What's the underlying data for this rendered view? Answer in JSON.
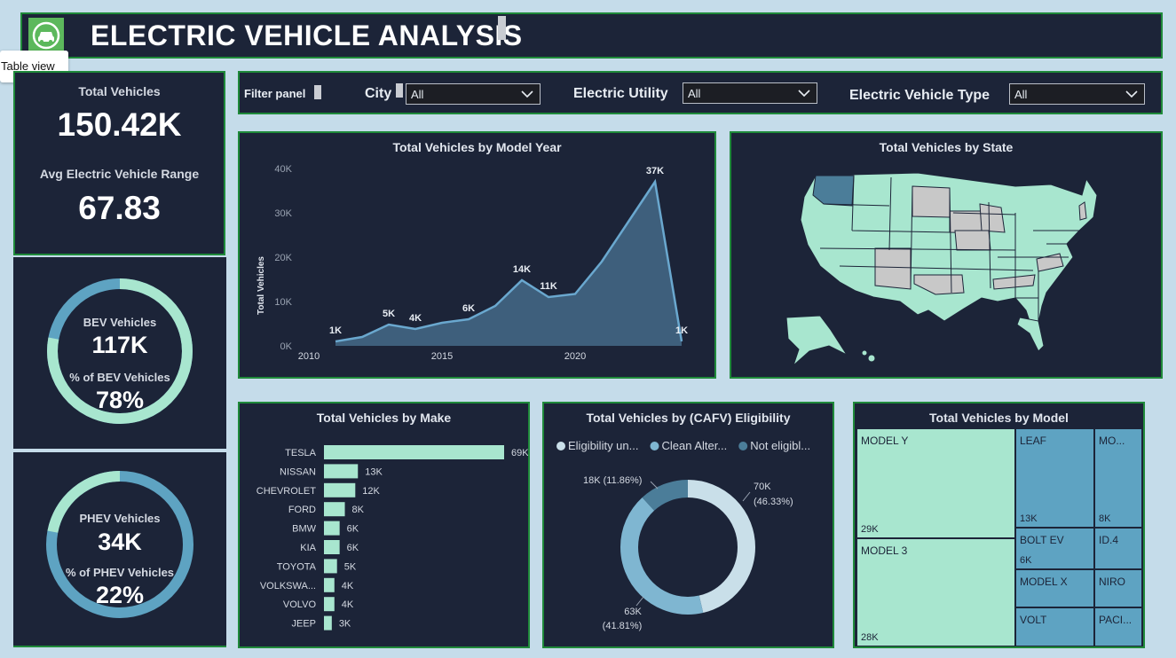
{
  "header": {
    "title": "ELECTRIC VEHICLE ANALYSIS",
    "logo_icon": "car-icon"
  },
  "tooltip": {
    "text": "Table view"
  },
  "kpi": {
    "total_label": "Total Vehicles",
    "total_value": "150.42K",
    "range_label": "Avg Electric Vehicle Range",
    "range_value": "67.83"
  },
  "bev": {
    "label": "BEV Vehicles",
    "value": "117K",
    "pct_label": "% of BEV Vehicles",
    "pct_value": "78%",
    "fraction": 0.78
  },
  "phev": {
    "label": "PHEV Vehicles",
    "value": "34K",
    "pct_label": "% of PHEV Vehicles",
    "pct_value": "22%",
    "fraction": 0.22
  },
  "filters": {
    "panel_label": "Filter panel",
    "city_label": "City",
    "city_value": "All",
    "utility_label": "Electric Utility",
    "utility_value": "All",
    "type_label": "Electric Vehicle Type",
    "type_value": "All"
  },
  "colors": {
    "mint": "#a8e6cf",
    "steel": "#5ea3c2",
    "navy": "#1c2438",
    "area": "#3e5f7c",
    "line": "#6aa8cf",
    "light": "#c9dfe9",
    "dark_teal": "#4b7d99",
    "border": "#1f8a3a"
  },
  "chart_data": [
    {
      "type": "area",
      "title": "Total Vehicles by Model Year",
      "ylabel": "Total Vehicles",
      "xlabel": "",
      "x": [
        2011,
        2012,
        2013,
        2014,
        2015,
        2016,
        2017,
        2018,
        2019,
        2020,
        2021,
        2022,
        2023,
        2024
      ],
      "values": [
        1000,
        2000,
        4800,
        3800,
        5200,
        6000,
        9000,
        14800,
        11000,
        11700,
        19000,
        28000,
        37000,
        1000
      ],
      "data_labels": [
        {
          "x": 2011,
          "text": "1K"
        },
        {
          "x": 2013,
          "text": "5K"
        },
        {
          "x": 2014,
          "text": "4K"
        },
        {
          "x": 2016,
          "text": "6K"
        },
        {
          "x": 2018,
          "text": "14K"
        },
        {
          "x": 2019,
          "text": "11K"
        },
        {
          "x": 2023,
          "text": "37K"
        },
        {
          "x": 2024,
          "text": "1K"
        }
      ],
      "yticks": [
        {
          "v": 0,
          "t": "0K"
        },
        {
          "v": 10000,
          "t": "10K"
        },
        {
          "v": 20000,
          "t": "20K"
        },
        {
          "v": 30000,
          "t": "30K"
        },
        {
          "v": 40000,
          "t": "40K"
        }
      ],
      "xticks": [
        {
          "v": 2010,
          "t": "2010"
        },
        {
          "v": 2015,
          "t": "2015"
        },
        {
          "v": 2020,
          "t": "2020"
        }
      ],
      "xlim": [
        2010,
        2024
      ],
      "ylim": [
        0,
        40000
      ]
    },
    {
      "type": "bar",
      "title": "Total Vehicles by Make",
      "categories": [
        "TESLA",
        "NISSAN",
        "CHEVROLET",
        "FORD",
        "BMW",
        "KIA",
        "TOYOTA",
        "VOLKSWA...",
        "VOLVO",
        "JEEP"
      ],
      "values": [
        69000,
        13000,
        12000,
        8000,
        6000,
        6000,
        5000,
        4000,
        4000,
        3000
      ],
      "value_labels": [
        "69K",
        "13K",
        "12K",
        "8K",
        "6K",
        "6K",
        "5K",
        "4K",
        "4K",
        "3K"
      ],
      "xlim": [
        0,
        69000
      ]
    },
    {
      "type": "pie",
      "title": "Total Vehicles by (CAFV) Eligibility",
      "legend": [
        {
          "name": "Eligibility un...",
          "color": "#c9dfe9"
        },
        {
          "name": "Clean Alter...",
          "color": "#7fb6d1"
        },
        {
          "name": "Not eligibl...",
          "color": "#4b7d99"
        }
      ],
      "slices": [
        {
          "name": "Eligibility un...",
          "value": 46.33,
          "label1": "70K",
          "label2": "(46.33%)",
          "color": "#c9dfe9"
        },
        {
          "name": "Clean Alter...",
          "value": 41.81,
          "label1": "63K",
          "label2": "(41.81%)",
          "color": "#7fb6d1"
        },
        {
          "name": "Not eligibl...",
          "value": 11.86,
          "label1": "18K (11.86%)",
          "label2": "",
          "color": "#4b7d99"
        }
      ]
    },
    {
      "type": "table",
      "title": "Total Vehicles by Model",
      "cells": [
        {
          "name": "MODEL Y",
          "value": "29K"
        },
        {
          "name": "MODEL 3",
          "value": "28K"
        },
        {
          "name": "LEAF",
          "value": "13K"
        },
        {
          "name": "MO...",
          "value": "8K"
        },
        {
          "name": "BOLT EV",
          "value": "6K"
        },
        {
          "name": "ID.4",
          "value": ""
        },
        {
          "name": "MODEL X",
          "value": ""
        },
        {
          "name": "NIRO",
          "value": ""
        },
        {
          "name": "VOLT",
          "value": ""
        },
        {
          "name": "PACI...",
          "value": ""
        }
      ]
    }
  ],
  "map": {
    "title": "Total Vehicles by State"
  }
}
